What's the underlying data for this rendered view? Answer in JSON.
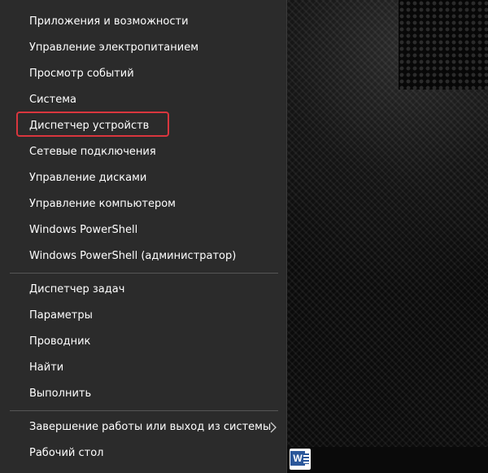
{
  "menu": {
    "group1": [
      {
        "label": "Приложения и возможности"
      },
      {
        "label": "Управление электропитанием"
      },
      {
        "label": "Просмотр событий"
      },
      {
        "label": "Система"
      },
      {
        "label": "Диспетчер устройств"
      },
      {
        "label": "Сетевые подключения"
      },
      {
        "label": "Управление дисками"
      },
      {
        "label": "Управление компьютером"
      },
      {
        "label": "Windows PowerShell"
      },
      {
        "label": "Windows PowerShell (администратор)"
      }
    ],
    "group2": [
      {
        "label": "Диспетчер задач"
      },
      {
        "label": "Параметры"
      },
      {
        "label": "Проводник"
      },
      {
        "label": "Найти"
      },
      {
        "label": "Выполнить"
      }
    ],
    "group3": [
      {
        "label": "Завершение работы или выход из системы",
        "submenu_icon": "chevron-right-icon"
      },
      {
        "label": "Рабочий стол"
      }
    ],
    "highlighted_item": "Диспетчер устройств",
    "highlight_color": "#d9363e",
    "background_color": "#2b2b2b",
    "text_color": "#ffffff"
  },
  "taskbar": {
    "icons": [
      "word-icon"
    ],
    "word_icon_letter": "W"
  }
}
